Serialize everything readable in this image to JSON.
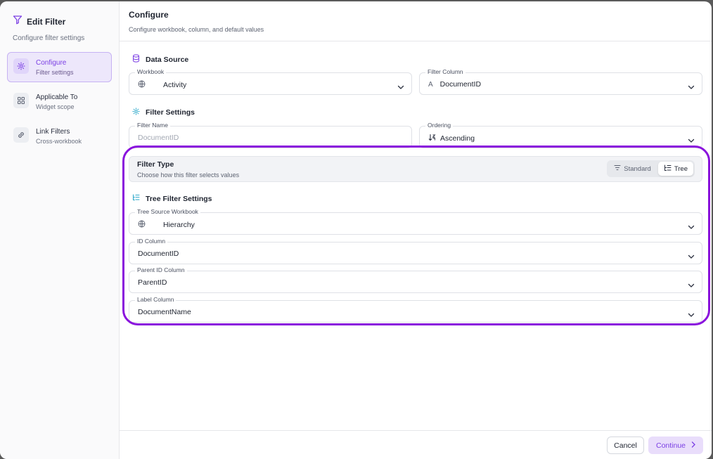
{
  "sidebar": {
    "title": "Edit Filter",
    "subtitle": "Configure filter settings",
    "items": [
      {
        "label": "Configure",
        "desc": "Filter settings",
        "icon": "gear-icon",
        "active": true
      },
      {
        "label": "Applicable To",
        "desc": "Widget scope",
        "icon": "grid-icon",
        "active": false
      },
      {
        "label": "Link Filters",
        "desc": "Cross-workbook",
        "icon": "link-icon",
        "active": false
      }
    ]
  },
  "header": {
    "title": "Configure",
    "subtitle": "Configure workbook, column, and default values"
  },
  "data_source": {
    "title": "Data Source",
    "workbook": {
      "label": "Workbook",
      "value": "Activity"
    },
    "filter_column": {
      "label": "Filter Column",
      "value": "DocumentID",
      "type_glyph": "A"
    }
  },
  "filter_settings": {
    "title": "Filter Settings",
    "filter_name": {
      "label": "Filter Name",
      "placeholder": "DocumentID"
    },
    "ordering": {
      "label": "Ordering",
      "value": "Ascending"
    }
  },
  "filter_type": {
    "title": "Filter Type",
    "subtitle": "Choose how this filter selects values",
    "options": [
      "Standard",
      "Tree"
    ],
    "selected": "Tree"
  },
  "tree_settings": {
    "title": "Tree Filter Settings",
    "source_workbook": {
      "label": "Tree Source Workbook",
      "value": "Hierarchy"
    },
    "id_column": {
      "label": "ID Column",
      "value": "DocumentID"
    },
    "parent_id_column": {
      "label": "Parent ID Column",
      "value": "ParentID"
    },
    "label_column": {
      "label": "Label Column",
      "value": "DocumentName"
    }
  },
  "footer": {
    "cancel_label": "Cancel",
    "continue_label": "Continue"
  },
  "colors": {
    "accent": "#7b3fe4",
    "highlight": "#8a12dd",
    "teal_icon": "#2aa7c9"
  }
}
